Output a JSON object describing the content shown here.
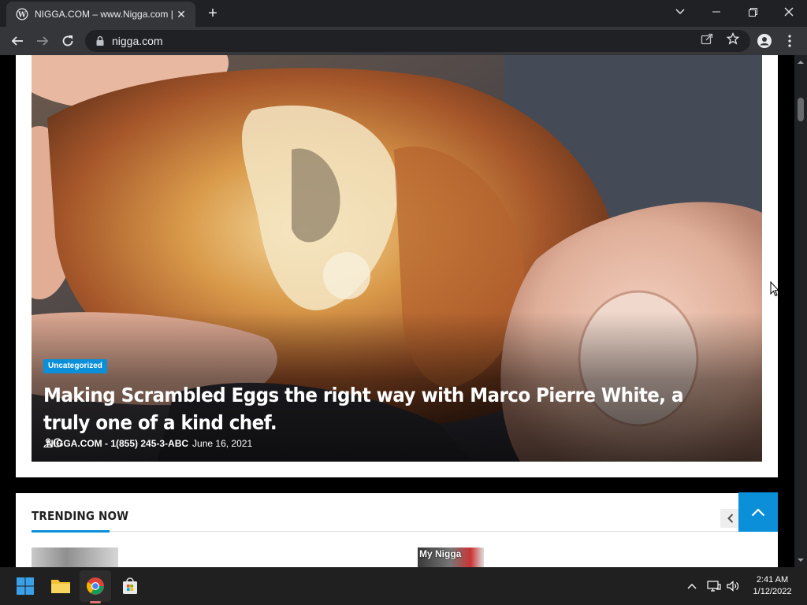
{
  "browser": {
    "tab_title": "NIGGA.COM – www.Nigga.com |",
    "url": "nigga.com"
  },
  "hero": {
    "category": "Uncategorized",
    "title": "Making Scrambled Eggs the right way with Marco Pierre White, a truly one of a kind chef.",
    "author": "NIGGA.COM - 1(855) 245-3-ABC",
    "date": "June 16, 2021"
  },
  "trending": {
    "heading": "TRENDING NOW",
    "items": [
      {
        "thumb_label": ""
      },
      {
        "thumb_label": "My Nigga"
      }
    ]
  },
  "taskbar": {
    "time": "2:41 AM",
    "date": "1/12/2022"
  },
  "colors": {
    "accent": "#0a8fd8",
    "chrome_dark": "#202124",
    "chrome_toolbar": "#35363a"
  }
}
